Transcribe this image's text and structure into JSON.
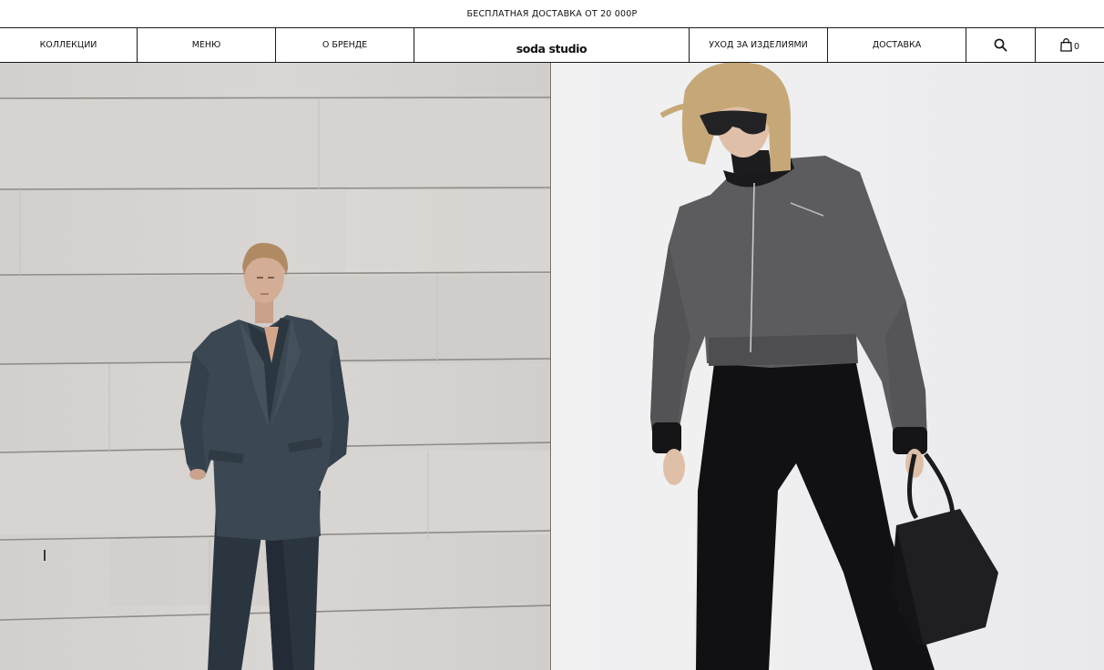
{
  "promo": {
    "text": "БЕСПЛАТНАЯ ДОСТАВКА ОТ 20 000Р"
  },
  "nav": {
    "items": [
      {
        "label": "КОЛЛЕКЦИИ"
      },
      {
        "label": "МЕНЮ"
      },
      {
        "label": "О БРЕНДЕ"
      },
      {
        "label": "УХОД ЗА ИЗДЕЛИЯМИ"
      },
      {
        "label": "ДОСТАВКА"
      }
    ],
    "logo": "soda studio",
    "search_icon": "search-icon",
    "cart_icon": "shopping-bag-icon",
    "cart_count": "0"
  },
  "hero": {
    "left_image": "model-in-oversized-grey-suit",
    "right_image": "model-in-grey-bomber-jacket-with-black-bag"
  },
  "colors": {
    "text": "#111111",
    "border": "#1a1a1a",
    "wall": "#d5d2cf",
    "studio": "#eeeef0",
    "suit": "#3a4550",
    "jacket": "#5e5e60"
  }
}
